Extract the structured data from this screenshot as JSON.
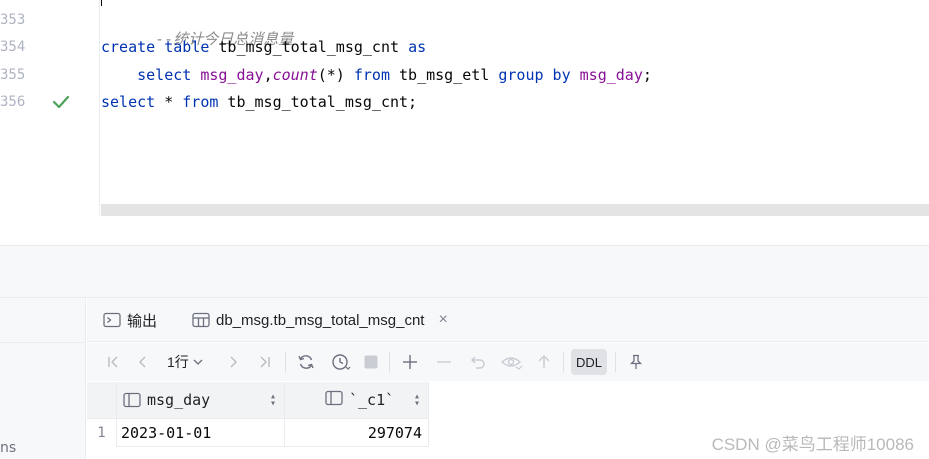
{
  "editor": {
    "line_numbers": [
      "353",
      "354",
      "355",
      "356"
    ],
    "lines": {
      "l1": "--统计今日总消息量",
      "l2_kw1": "create table",
      "l2_id": " tb_msg_total_msg_cnt ",
      "l2_kw2": "as",
      "l3_indent": "    ",
      "l3_kw1": "select",
      "l3_sp1": " ",
      "l3_col": "msg_day",
      "l3_comma": ",",
      "l3_fn": "count",
      "l3_args": "(*) ",
      "l3_kw2": "from",
      "l3_tbl": " tb_msg_etl ",
      "l3_kw3": "group by",
      "l3_sp2": " ",
      "l3_col2": "msg_day",
      "l3_end": ";",
      "l4_kw1": "select",
      "l4_star": " * ",
      "l4_kw2": "from",
      "l4_rest": " tb_msg_total_msg_cnt;"
    }
  },
  "tabs": {
    "output_label": "输出",
    "result_label": "db_msg.tb_msg_total_msg_cnt",
    "close_glyph": "×"
  },
  "toolbar": {
    "page": "1行",
    "ddl_label": "DDL"
  },
  "grid": {
    "columns": [
      "msg_day",
      "`_c1`"
    ],
    "rows": [
      {
        "num": "1",
        "cells": [
          "2023-01-01",
          "297074"
        ]
      }
    ]
  },
  "left_stub_text": "ns",
  "watermark": "CSDN @菜鸟工程师10086",
  "colors": {
    "keyword": "#0033b3",
    "identifier": "#871094",
    "comment": "#8c8c8c",
    "check": "#4da35a"
  }
}
